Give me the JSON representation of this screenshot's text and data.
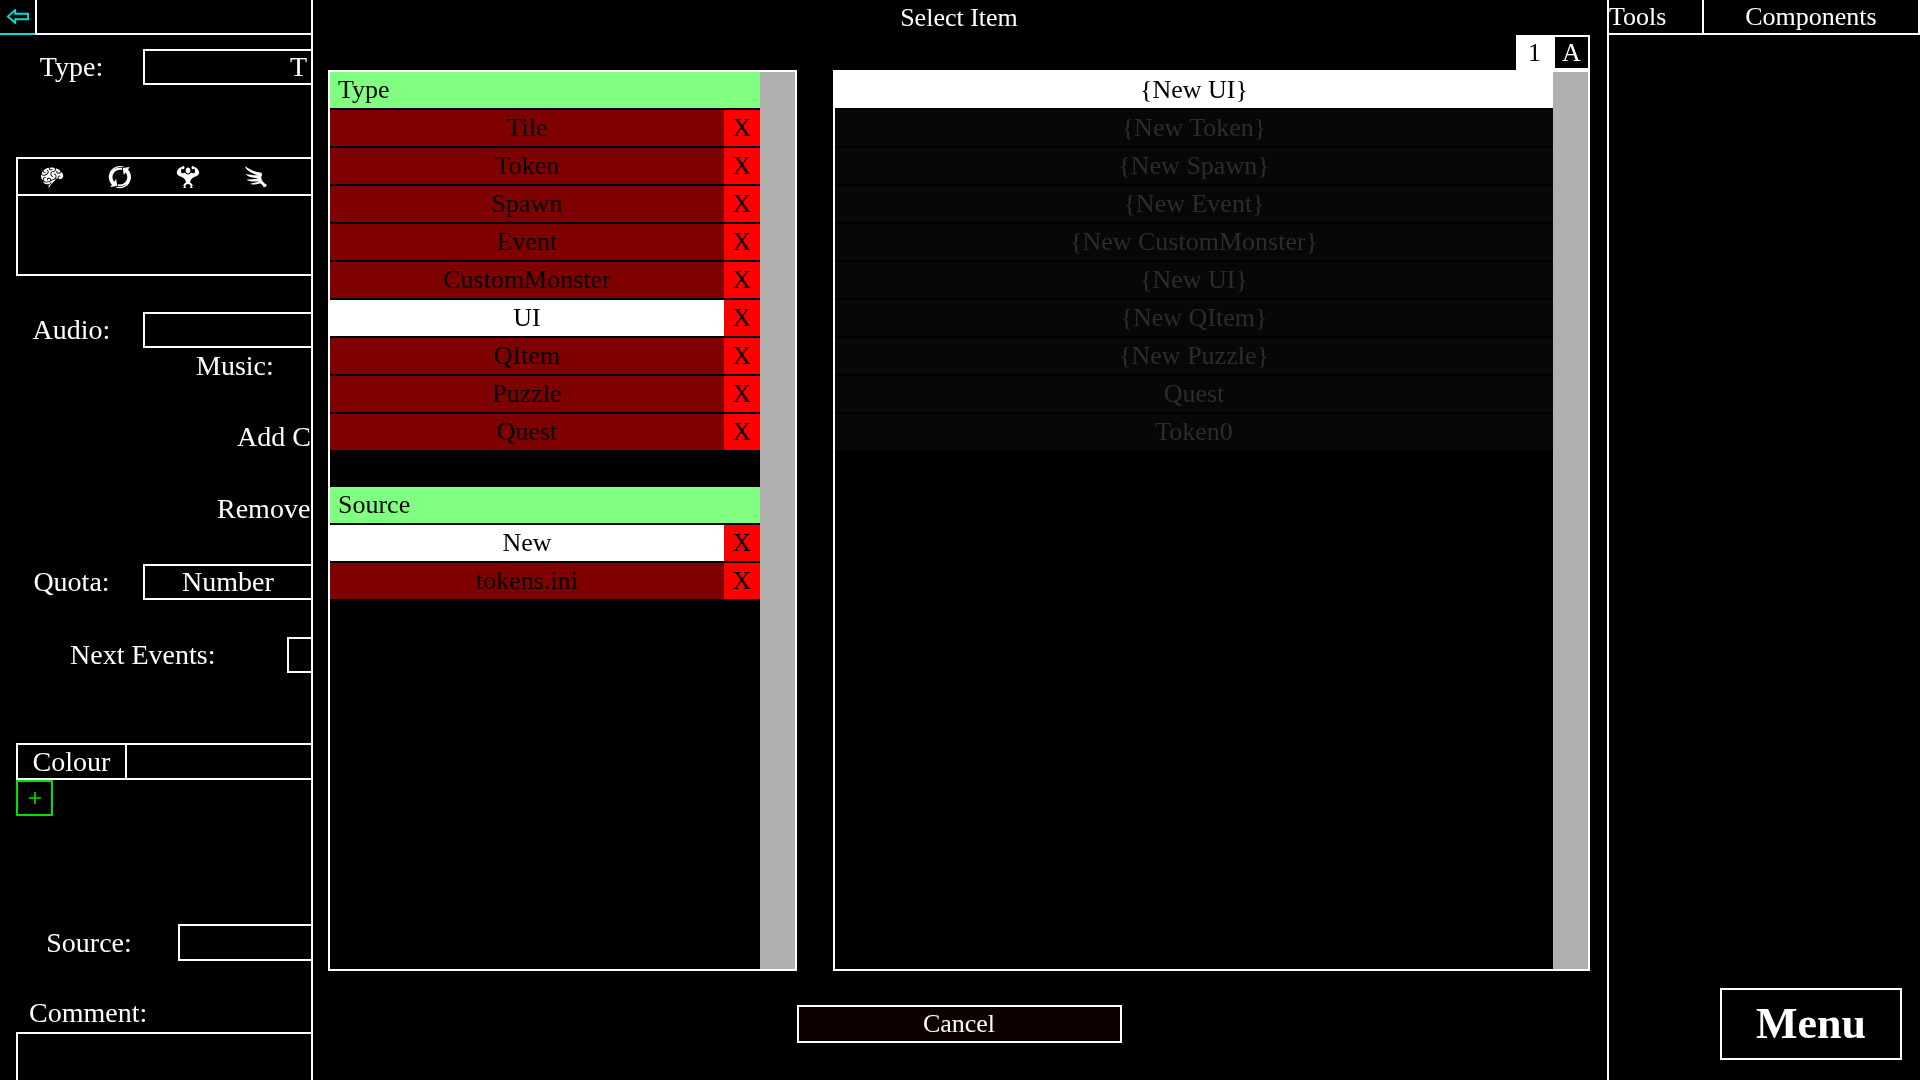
{
  "editor": {
    "type_label": "Type:",
    "type_value": "T",
    "audio_label": "Audio:",
    "music_label": "Music:",
    "add_label": "Add C",
    "remove_label": "Remove",
    "quota_label": "Quota:",
    "quota_value": "Number",
    "next_events_label": "Next Events:",
    "colour_label": "Colour",
    "source_label": "Source:",
    "comment_label": "Comment:"
  },
  "dialog": {
    "title": "Select Item",
    "sort_buttons": [
      {
        "label": "1",
        "selected": true
      },
      {
        "label": "A",
        "selected": false
      }
    ],
    "filters": [
      {
        "heading": "Type",
        "options": [
          {
            "label": "Tile",
            "selected": false,
            "remove": "X"
          },
          {
            "label": "Token",
            "selected": false,
            "remove": "X"
          },
          {
            "label": "Spawn",
            "selected": false,
            "remove": "X"
          },
          {
            "label": "Event",
            "selected": false,
            "remove": "X"
          },
          {
            "label": "CustomMonster",
            "selected": false,
            "remove": "X"
          },
          {
            "label": "UI",
            "selected": true,
            "remove": "X"
          },
          {
            "label": "QItem",
            "selected": false,
            "remove": "X"
          },
          {
            "label": "Puzzle",
            "selected": false,
            "remove": "X"
          },
          {
            "label": "Quest",
            "selected": false,
            "remove": "X"
          }
        ]
      },
      {
        "heading": "Source",
        "options": [
          {
            "label": "New",
            "selected": true,
            "remove": "X"
          },
          {
            "label": "tokens.ini",
            "selected": false,
            "remove": "X"
          }
        ]
      }
    ],
    "items": [
      {
        "label": "{New UI}",
        "dimmed": false
      },
      {
        "label": "{New Token}",
        "dimmed": true
      },
      {
        "label": "{New Spawn}",
        "dimmed": true
      },
      {
        "label": "{New Event}",
        "dimmed": true
      },
      {
        "label": "{New CustomMonster}",
        "dimmed": true
      },
      {
        "label": "{New UI}",
        "dimmed": true
      },
      {
        "label": "{New QItem}",
        "dimmed": true
      },
      {
        "label": "{New Puzzle}",
        "dimmed": true
      },
      {
        "label": "Quest",
        "dimmed": true
      },
      {
        "label": "Token0",
        "dimmed": true
      }
    ],
    "cancel": "Cancel"
  },
  "sidebar": {
    "tabs": [
      "Tools",
      "Components"
    ],
    "menu": "Menu"
  }
}
